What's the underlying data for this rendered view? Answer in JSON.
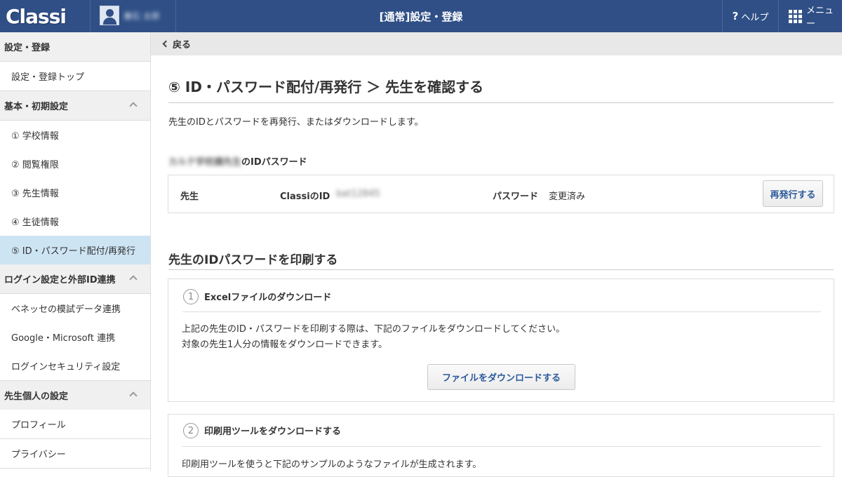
{
  "header": {
    "logo": "Classi",
    "user_name": "兼石 太郎",
    "title": "[通常]設定・登録",
    "help_label": "ヘルプ",
    "menu_label": "メニュー"
  },
  "sidebar": {
    "items": [
      {
        "type": "head",
        "label": "設定・登録"
      },
      {
        "type": "item",
        "label": "設定・登録トップ"
      },
      {
        "type": "head",
        "label": "基本・初期設定"
      },
      {
        "type": "item",
        "label": "① 学校情報"
      },
      {
        "type": "item",
        "label": "② 閲覧権限"
      },
      {
        "type": "item",
        "label": "③ 先生情報"
      },
      {
        "type": "item",
        "label": "④ 生徒情報"
      },
      {
        "type": "item",
        "label": "⑤ ID・パスワード配付/再発行"
      },
      {
        "type": "head",
        "label": "ログイン設定と外部ID連携"
      },
      {
        "type": "item",
        "label": "ベネッセの模試データ連携"
      },
      {
        "type": "item",
        "label": "Google・Microsoft 連携"
      },
      {
        "type": "item",
        "label": "ログインセキュリティ設定"
      },
      {
        "type": "head",
        "label": "先生個人の設定"
      },
      {
        "type": "item",
        "label": "プロフィール"
      },
      {
        "type": "item",
        "label": "プライバシー"
      }
    ]
  },
  "main": {
    "back_label": "戻る",
    "page_title": "⑤ ID・パスワード配付/再発行 ＞ 先生を確認する",
    "description": "先生のIDとパスワードを再発行、またはダウンロードします。",
    "id_section": {
      "teacher_name": "カルテ学校講先生",
      "title_suffix": "のIDパスワード",
      "role_label": "先生",
      "id_label": "ClassiのID",
      "id_value": "bat12845",
      "password_label": "パスワード",
      "password_value": "変更済み",
      "reissue_button": "再発行する"
    },
    "print_section": {
      "title": "先生のIDパスワードを印刷する",
      "step1": {
        "number": "1",
        "title": "Excelファイルのダウンロード",
        "text1": "上記の先生のID・パスワードを印刷する際は、下記のファイルをダウンロードしてください。",
        "text2": "対象の先生1人分の情報をダウンロードできます。",
        "button": "ファイルをダウンロードする"
      },
      "step2": {
        "number": "2",
        "title": "印刷用ツールをダウンロードする",
        "text1": "印刷用ツールを使うと下記のサンプルのようなファイルが生成されます。"
      }
    }
  }
}
